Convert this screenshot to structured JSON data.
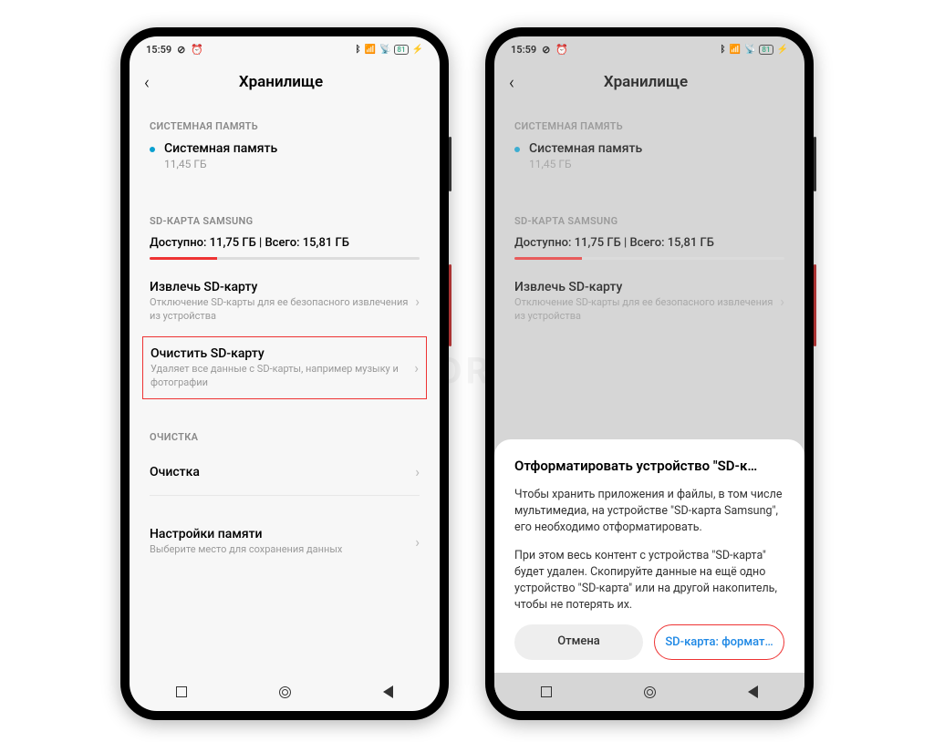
{
  "status": {
    "time": "15:59",
    "battery": "81"
  },
  "header": {
    "title": "Хранилище"
  },
  "sections": {
    "system_label": "СИСТЕМНАЯ ПАМЯТЬ",
    "system_title": "Системная память",
    "system_size": "11,45 ГБ",
    "sd_label": "SD-КАРТА SAMSUNG",
    "sd_available": "Доступно: 11,75 ГБ | Всего: 15,81 ГБ",
    "eject_title": "Извлечь SD-карту",
    "eject_sub": "Отключение SD-карты для ее безопасного извлечения из устройства",
    "clear_title": "Очистить SD-карту",
    "clear_sub": "Удаляет все данные с SD-карты, например музыку и фотографии",
    "cleanup_label": "ОЧИСТКА",
    "cleanup_title": "Очистка",
    "settings_title": "Настройки памяти",
    "settings_sub": "Выберите место для сохранения данных"
  },
  "dialog": {
    "title": "Отформатировать устройство \"SD-к…",
    "p1": "Чтобы хранить приложения и файлы, в том числе мультимедиа, на устройстве \"SD-карта Samsung\", его необходимо отформатировать.",
    "p2": "При этом весь контент с устройства \"SD-карта\" будет удален. Скопируйте данные на ещё одно устройство \"SD-карта\" или на другой накопитель, чтобы не потерять их.",
    "cancel": "Отмена",
    "format": "SD-карта: формат…"
  },
  "watermark": "SIBDROID"
}
